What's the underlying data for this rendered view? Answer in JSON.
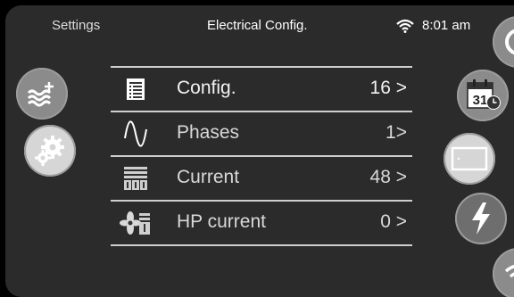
{
  "header": {
    "back_label": "Settings",
    "title": "Electrical Config.",
    "time": "8:01 am",
    "wifi_icon": "wifi-icon"
  },
  "left_sidebar": [
    {
      "name": "water-heating-icon"
    },
    {
      "name": "settings-gears-icon"
    }
  ],
  "right_sidebar": [
    {
      "name": "gauge-icon"
    },
    {
      "name": "calendar-schedule-icon",
      "text": "31"
    },
    {
      "name": "display-panel-icon"
    },
    {
      "name": "lightning-icon"
    },
    {
      "name": "wifi-icon"
    }
  ],
  "menu": [
    {
      "label": "Config.",
      "value": "16 >",
      "icon": "list-icon"
    },
    {
      "label": "Phases",
      "value": "1>",
      "icon": "sine-wave-icon"
    },
    {
      "label": "Current",
      "value": "48 >",
      "icon": "breaker-panel-icon"
    },
    {
      "label": "HP current",
      "value": "0 >",
      "icon": "fan-breaker-icon"
    }
  ],
  "colors": {
    "background": "#2b2b2b",
    "button_gray": "#8b8b8b",
    "button_light": "#d6d6d6",
    "divider": "#cfcfcf"
  }
}
